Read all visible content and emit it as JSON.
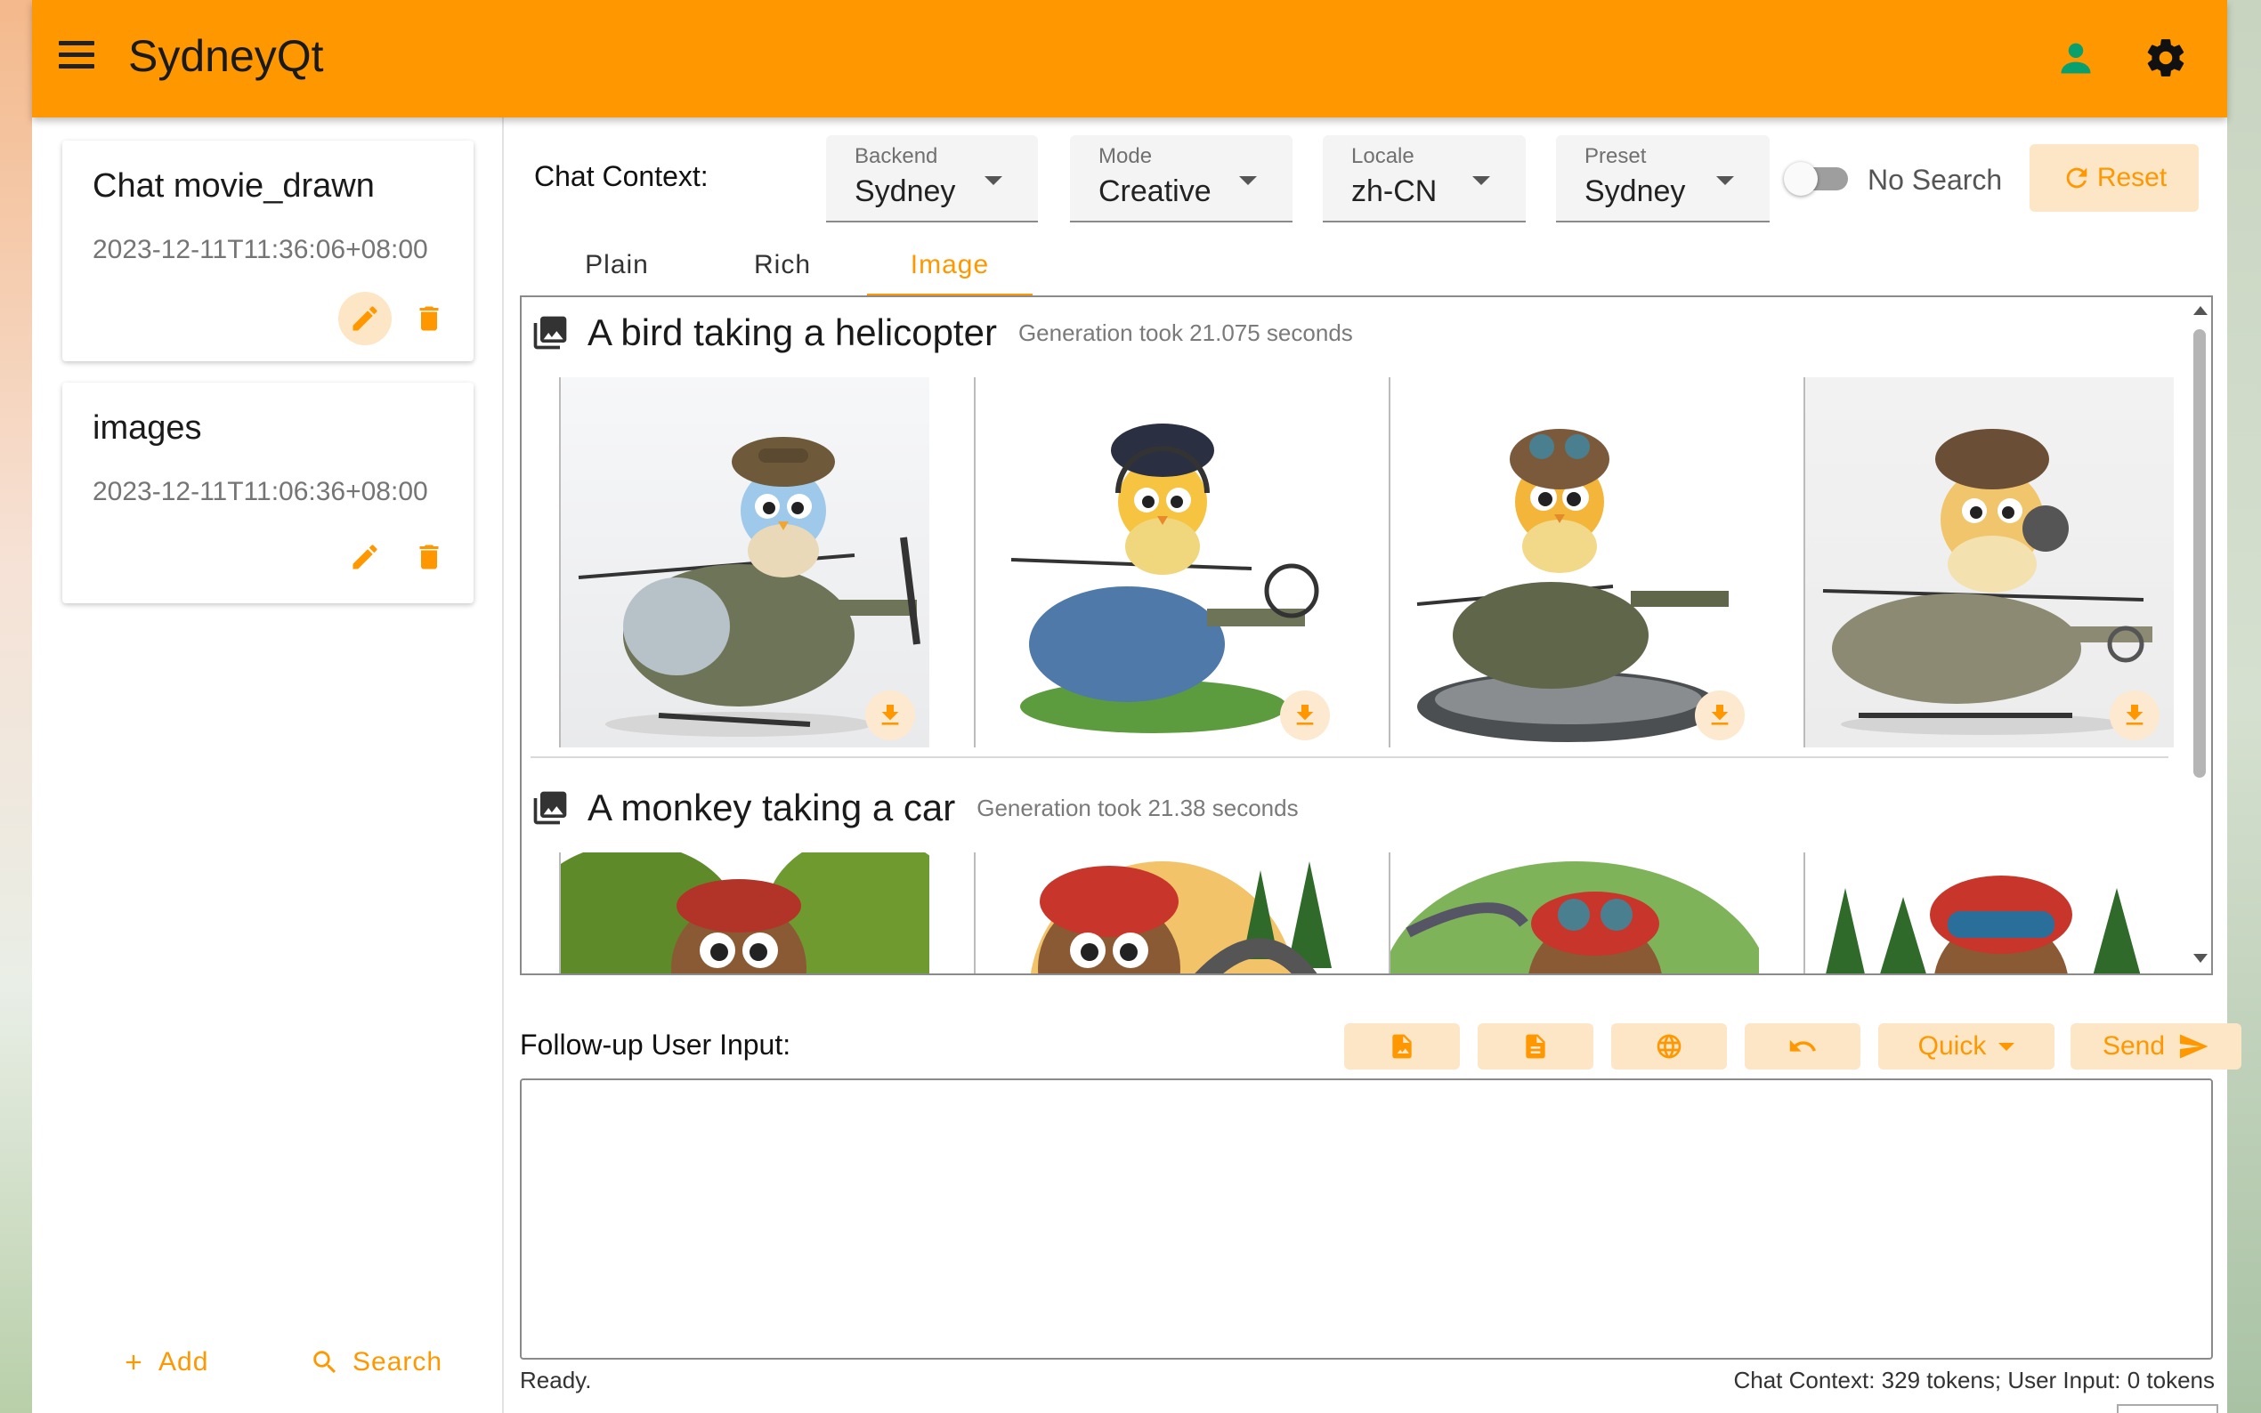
{
  "app": {
    "title": "SydneyQt"
  },
  "sidebar": {
    "chats": [
      {
        "title": "Chat movie_drawn",
        "date": "2023-12-11T11:36:06+08:00"
      },
      {
        "title": "images",
        "date": "2023-12-11T11:06:36+08:00"
      }
    ],
    "add_label": "Add",
    "search_label": "Search"
  },
  "context": {
    "label": "Chat Context:",
    "backend": {
      "label": "Backend",
      "value": "Sydney"
    },
    "mode": {
      "label": "Mode",
      "value": "Creative"
    },
    "locale": {
      "label": "Locale",
      "value": "zh-CN"
    },
    "preset": {
      "label": "Preset",
      "value": "Sydney"
    },
    "no_search_label": "No Search",
    "reset_label": "Reset"
  },
  "tabs": [
    {
      "label": "Plain"
    },
    {
      "label": "Rich"
    },
    {
      "label": "Image"
    }
  ],
  "generations": [
    {
      "title": "A bird taking a helicopter",
      "time": "Generation took 21.075 seconds"
    },
    {
      "title": "A monkey taking a car",
      "time": "Generation took 21.38 seconds"
    }
  ],
  "followup": {
    "label": "Follow-up User Input:",
    "quick_label": "Quick",
    "send_label": "Send",
    "input_value": ""
  },
  "status": {
    "left": "Ready.",
    "right": "Chat Context: 329 tokens; User Input: 0 tokens"
  },
  "colors": {
    "accent": "#ff9800",
    "accent_light": "#fde6c6"
  }
}
